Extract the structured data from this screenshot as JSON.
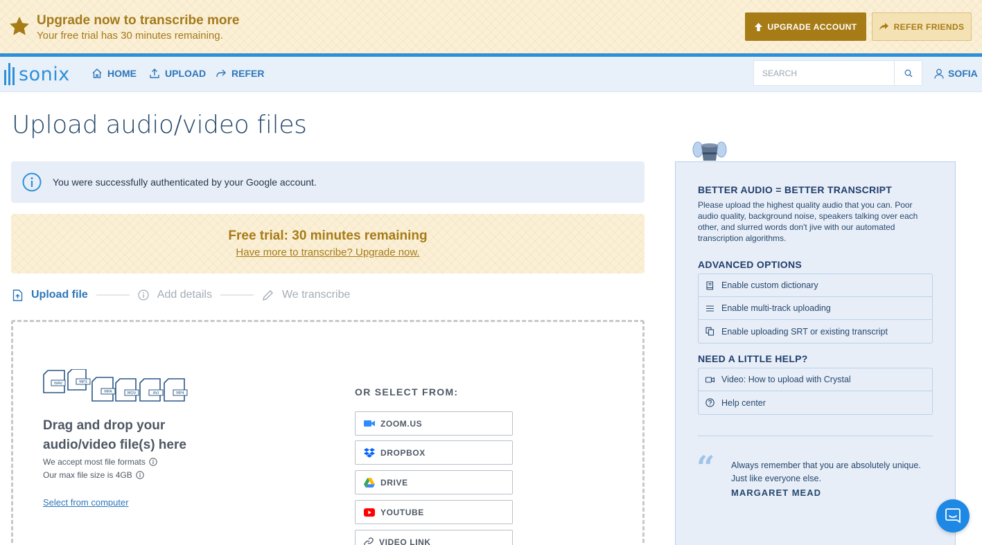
{
  "banner": {
    "title": "Upgrade now to transcribe more",
    "subtitle": "Your free trial has 30 minutes remaining.",
    "upgrade_label": "UPGRADE ACCOUNT",
    "refer_label": "REFER FRIENDS"
  },
  "nav": {
    "logo": "sonix",
    "home": "HOME",
    "upload": "UPLOAD",
    "refer": "REFER",
    "search_placeholder": "SEARCH",
    "user": "SOFIA"
  },
  "main": {
    "title": "Upload audio/video files",
    "info": "You were successfully authenticated by your Google account.",
    "trial_title": "Free trial: 30 minutes remaining",
    "trial_link": "Have more to transcribe? Upgrade now.",
    "steps": [
      "Upload file",
      "Add details",
      "We transcribe"
    ],
    "dropzone": {
      "formats": [
        "WAV",
        "MP3",
        "MPA",
        "MOV",
        "AVI",
        "MP4"
      ],
      "title": "Drag and drop your audio/video file(s) here",
      "note1": "We accept most file formats",
      "note2": "Our max file size is 4GB",
      "select_link": "Select from computer",
      "or_select": "OR SELECT FROM:",
      "sources": [
        "ZOOM.US",
        "DROPBOX",
        "DRIVE",
        "YOUTUBE",
        "VIDEO LINK"
      ]
    }
  },
  "sidebar": {
    "better_title": "BETTER AUDIO = BETTER TRANSCRIPT",
    "better_text": "Please upload the highest quality audio that you can. Poor audio quality, background noise, speakers talking over each other, and slurred words don't jive with our automated transcription algorithms.",
    "advanced_title": "ADVANCED OPTIONS",
    "advanced_options": [
      "Enable custom dictionary",
      "Enable multi-track uploading",
      "Enable uploading SRT or existing transcript"
    ],
    "help_title": "NEED A LITTLE HELP?",
    "help_options": [
      "Video: How to upload with Crystal",
      "Help center"
    ],
    "quote": "Always remember that you are absolutely unique. Just like everyone else.",
    "quote_author": "MARGARET MEAD"
  },
  "colors": {
    "brand_blue": "#2e8fd8",
    "gold": "#a77b16",
    "banner_bg": "#fbf0d6",
    "panel_bg": "#e8eef8"
  }
}
